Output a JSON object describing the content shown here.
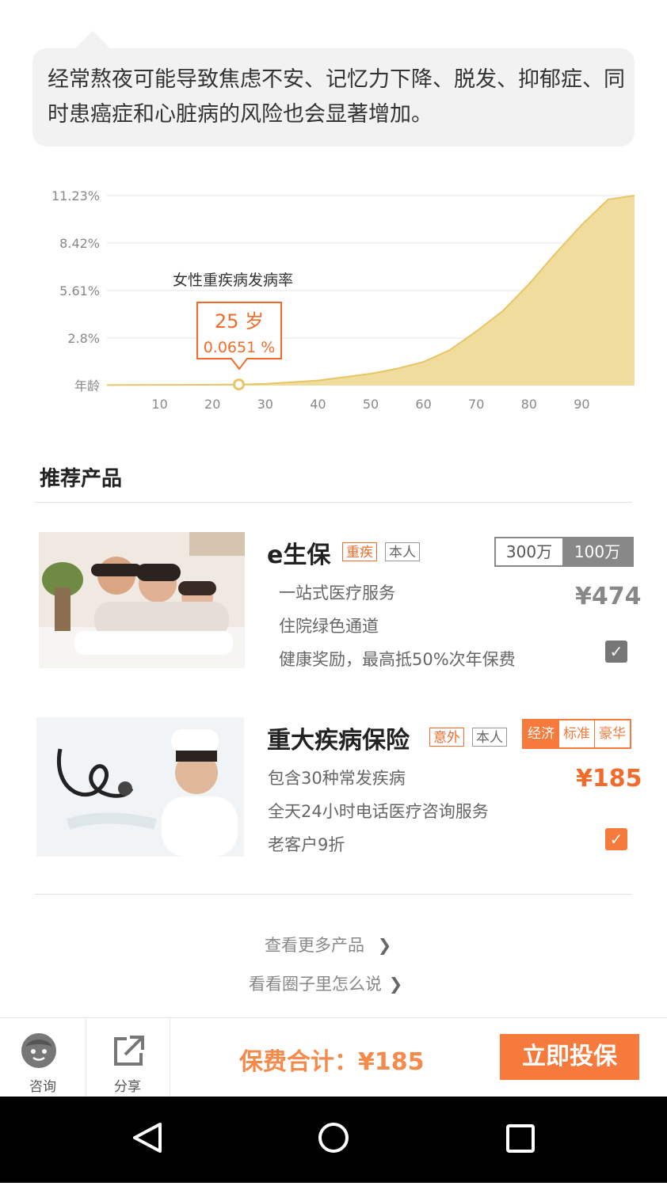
{
  "tip": {
    "text": "经常熬夜可能导致焦虑不安、记忆力下降、脱发、抑郁症、同时患癌症和心脏病的风险也会显著增加。"
  },
  "chart_data": {
    "type": "area",
    "title": "女性重疾病发病率",
    "yticks": [
      "11.23%",
      "8.42%",
      "5.61%",
      "2.8%",
      "年龄"
    ],
    "xticks": [
      "10",
      "20",
      "30",
      "40",
      "50",
      "60",
      "70",
      "80",
      "90"
    ],
    "xlim": [
      0,
      100
    ],
    "ylim": [
      0,
      11.23
    ],
    "grid": true,
    "x": [
      0,
      10,
      20,
      25,
      30,
      40,
      50,
      55,
      60,
      65,
      70,
      75,
      80,
      85,
      90,
      95,
      100
    ],
    "y": [
      0.03,
      0.04,
      0.05,
      0.0651,
      0.1,
      0.3,
      0.7,
      1.0,
      1.4,
      2.1,
      3.2,
      4.4,
      6.0,
      7.8,
      9.5,
      11.0,
      11.23
    ],
    "marker": {
      "x": 25,
      "y": 0.0651,
      "label_age": "25 岁",
      "label_rate": "0.0651 %"
    },
    "fill_color": "#f0dc9c",
    "line_color": "#e8c567",
    "marker_color": "#f26b2b"
  },
  "section": {
    "title": "推荐产品"
  },
  "products": [
    {
      "name": "e生保",
      "tag1": "重疾",
      "tag2": "本人",
      "features": [
        "一站式医疗服务",
        "住院绿色通道",
        "健康奖励，最高抵50%次年保费"
      ],
      "options": [
        "300万",
        "100万"
      ],
      "price": "¥474",
      "checked": true,
      "price_color": "#888888"
    },
    {
      "name": "重大疾病保险",
      "tag1": "意外",
      "tag2": "本人",
      "features": [
        "包含30种常发疾病",
        "全天24小时电话医疗咨询服务",
        "老客户9折"
      ],
      "options": [
        "经济",
        "标准",
        "豪华"
      ],
      "price": "¥185",
      "checked": true,
      "price_color": "#f26b2b"
    }
  ],
  "links": {
    "more_products": "查看更多产品",
    "circle": "看看圈子里怎么说"
  },
  "bottom": {
    "consult": "咨询",
    "share": "分享",
    "total": "保费合计：¥185",
    "buy": "立即投保"
  },
  "colors": {
    "accent": "#f57a3c",
    "check_gray": "#777777"
  }
}
